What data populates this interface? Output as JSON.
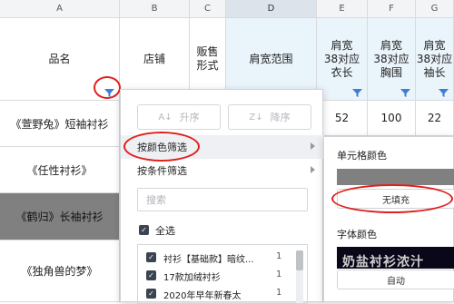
{
  "columns": [
    {
      "letter": "A",
      "header": "品名",
      "has_filter": true
    },
    {
      "letter": "B",
      "header": "店铺",
      "has_filter": false
    },
    {
      "letter": "C",
      "header": "贩售\n形式",
      "has_filter": false
    },
    {
      "letter": "D",
      "header": "肩宽范围",
      "has_filter": false
    },
    {
      "letter": "E",
      "header": "肩宽\n38对应\n衣长",
      "has_filter": true
    },
    {
      "letter": "F",
      "header": "肩宽\n38对应\n胸围",
      "has_filter": true
    },
    {
      "letter": "G",
      "header": "肩宽\n38对应\n袖长",
      "has_filter": true
    }
  ],
  "rows": [
    {
      "name": "《萱野兔》短袖衬衫",
      "e": "52",
      "f": "100",
      "g": "22"
    },
    {
      "name": "《任性衬衫》",
      "e": "",
      "f": "",
      "g": ""
    },
    {
      "name": "《鹤归》长袖衬衫",
      "e": "",
      "f": "",
      "g": ""
    },
    {
      "name": "《独角兽的梦》",
      "e": "",
      "f": "",
      "g": ""
    }
  ],
  "filter_menu": {
    "sort_asc": "升序",
    "sort_desc": "降序",
    "filter_by_color": "按颜色筛选",
    "filter_by_condition": "按条件筛选",
    "search_placeholder": "搜索",
    "select_all": "全选",
    "items": [
      {
        "label": "衬衫【基础款】暗纹...",
        "count": "1"
      },
      {
        "label": "17款加绒衬衫",
        "count": "1"
      },
      {
        "label": "2020年早年新春太",
        "count": "1"
      }
    ]
  },
  "color_submenu": {
    "cell_color_title": "单元格颜色",
    "no_fill": "无填充",
    "font_color_title": "字体颜色",
    "font_preview_text": "奶盐衬衫浓汁",
    "auto": "自动"
  },
  "colors": {
    "gray_fill": "#808080",
    "accent_circle": "#e0201c",
    "filter_icon": "#3b7ddd",
    "highlight_header": "#eaf4fb"
  }
}
